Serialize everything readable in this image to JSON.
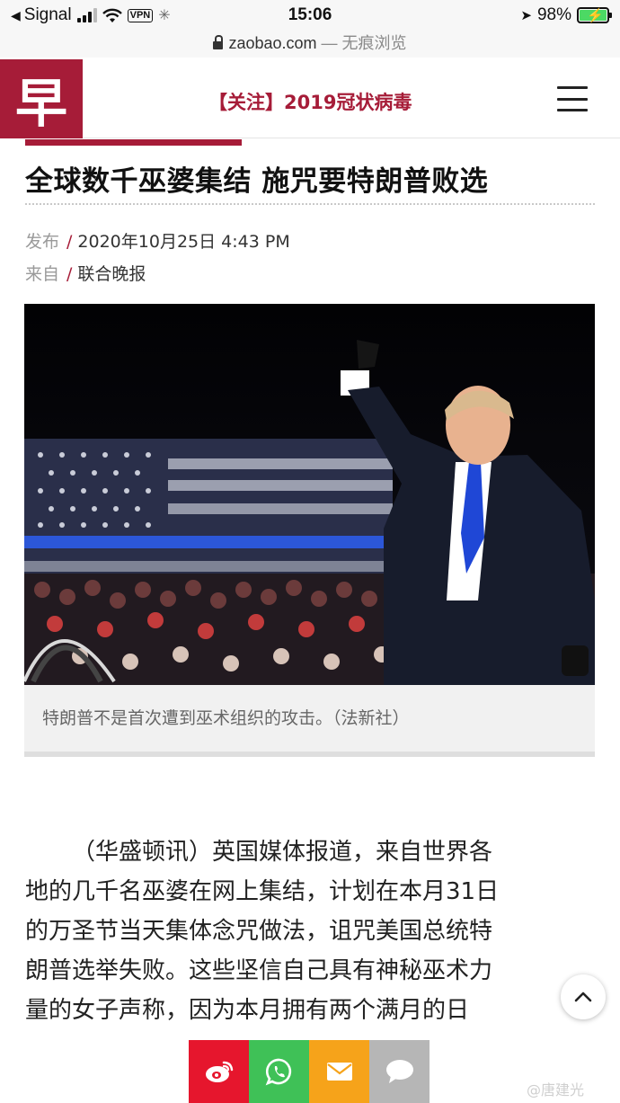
{
  "status_bar": {
    "back_app": "Signal",
    "vpn": "VPN",
    "time": "15:06",
    "battery": "98%"
  },
  "browser": {
    "domain": "zaobao.com",
    "mode": "— 无痕浏览"
  },
  "site": {
    "logo_char": "早",
    "topic_link": "【关注】2019冠状病毒",
    "accent_color": "#a61c38"
  },
  "article": {
    "headline": "全球数千巫婆集结 施咒要特朗普败选",
    "publish_label": "发布",
    "publish_date": "2020年10月25日 4:43 PM",
    "source_label": "来自",
    "source_name": "联合晚报",
    "image_caption": "特朗普不是首次遭到巫术组织的攻击。（法新社）",
    "body_lines": [
      "（华盛顿讯）英国媒体报道，来自世界各",
      "地的几千名巫婆在网上集结，计划在本月31日",
      "的万圣节当天集体念咒做法，诅咒美国总统特",
      "朗普选举失败。这些坚信自己具有神秘巫术力",
      "量的女子声称，因为本月拥有两个满月的日"
    ]
  },
  "share": {
    "weibo_icon": "weibo-icon",
    "whatsapp_icon": "whatsapp-icon",
    "email_icon": "email-icon",
    "sms_icon": "message-icon",
    "colors": {
      "weibo": "#e6162d",
      "whatsapp": "#3fc157",
      "email": "#f6a31a",
      "sms": "#b6b6b6"
    }
  },
  "watermark": "@唐建光"
}
